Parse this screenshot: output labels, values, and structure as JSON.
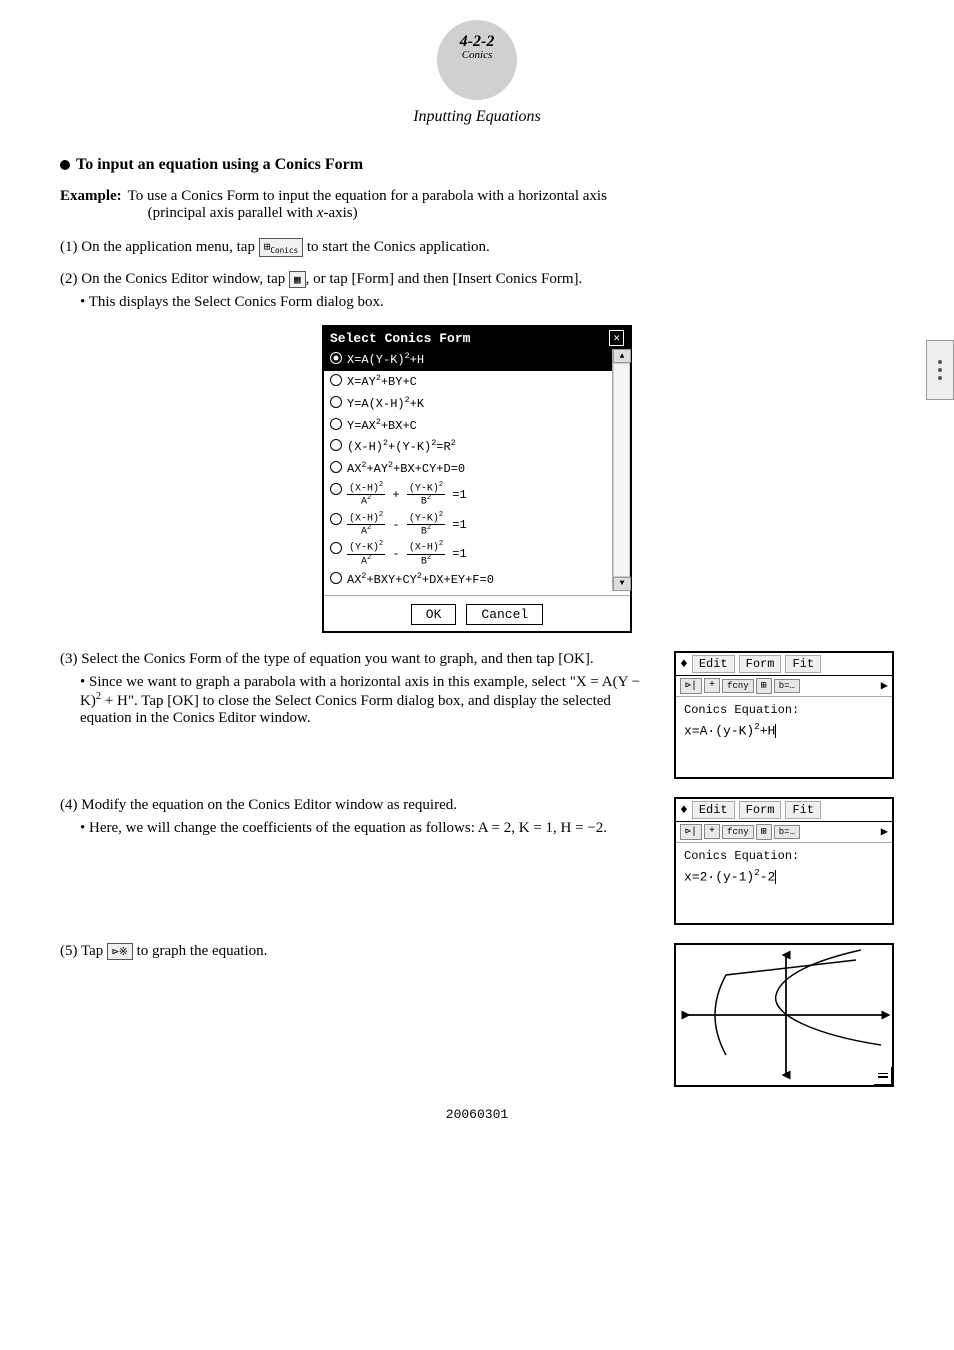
{
  "header": {
    "section": "4-2-2",
    "subtitle": "Conics",
    "title": "Inputting Equations"
  },
  "section_title": "To input an equation using a Conics Form",
  "example": {
    "label": "Example:",
    "text": "To use a Conics Form to input the equation for a parabola with a horizontal axis (principal axis parallel with x-axis)"
  },
  "steps": {
    "step1": "(1) On the application menu, tap [icon] to start the Conics application.",
    "step2": "(2) On the Conics Editor window, tap [icon], or tap [Form] and then [Insert Conics Form].",
    "step2_bullet": "This displays the Select Conics Form dialog box.",
    "step3_text": "(3) Select the Conics Form of the type of equation you want to graph, and then tap [OK].",
    "step3_bullet": "Since we want to graph a parabola with a horizontal axis in this example, select \"X = A(Y − K)² + H\". Tap [OK] to close the Select Conics Form dialog box, and display the selected equation in the Conics Editor window.",
    "step4_text": "(4) Modify the equation on the Conics Editor window as required.",
    "step4_bullet": "Here, we will change the coefficients of the equation as follows: A = 2, K = 1, H = −2.",
    "step5_text": "(5) Tap [icon] to graph the equation."
  },
  "dialog": {
    "title": "Select Conics Form",
    "equations": [
      {
        "selected": true,
        "formula": "X=A(Y-K)²+H"
      },
      {
        "selected": false,
        "formula": "X=AY²+BY+C"
      },
      {
        "selected": false,
        "formula": "Y=A(X-H)²+K"
      },
      {
        "selected": false,
        "formula": "Y=AX²+BX+C"
      },
      {
        "selected": false,
        "formula": "(X-H)²+(Y-K)²=R²"
      },
      {
        "selected": false,
        "formula": "AX²+AY²+BX+CY+D=0"
      },
      {
        "selected": false,
        "formula": "(X-H)²/A² + (Y-K)²/B² =1"
      },
      {
        "selected": false,
        "formula": "(X-H)²/A² - (Y-K)²/B² =1"
      },
      {
        "selected": false,
        "formula": "(Y-K)²/A² - (X-H)²/B² =1"
      },
      {
        "selected": false,
        "formula": "AX²+BXY+CY²+DX+EY+F=0"
      }
    ],
    "ok_label": "OK",
    "cancel_label": "Cancel"
  },
  "editor1": {
    "tabs": [
      "Edit",
      "Form",
      "Fit"
    ],
    "equation_label": "Conics Equation:",
    "equation": "x=A·(y-K)²+H"
  },
  "editor2": {
    "tabs": [
      "Edit",
      "Form",
      "Fit"
    ],
    "equation_label": "Conics Equation:",
    "equation": "x=2·(y-1)²-2"
  },
  "page_number": "20060301"
}
